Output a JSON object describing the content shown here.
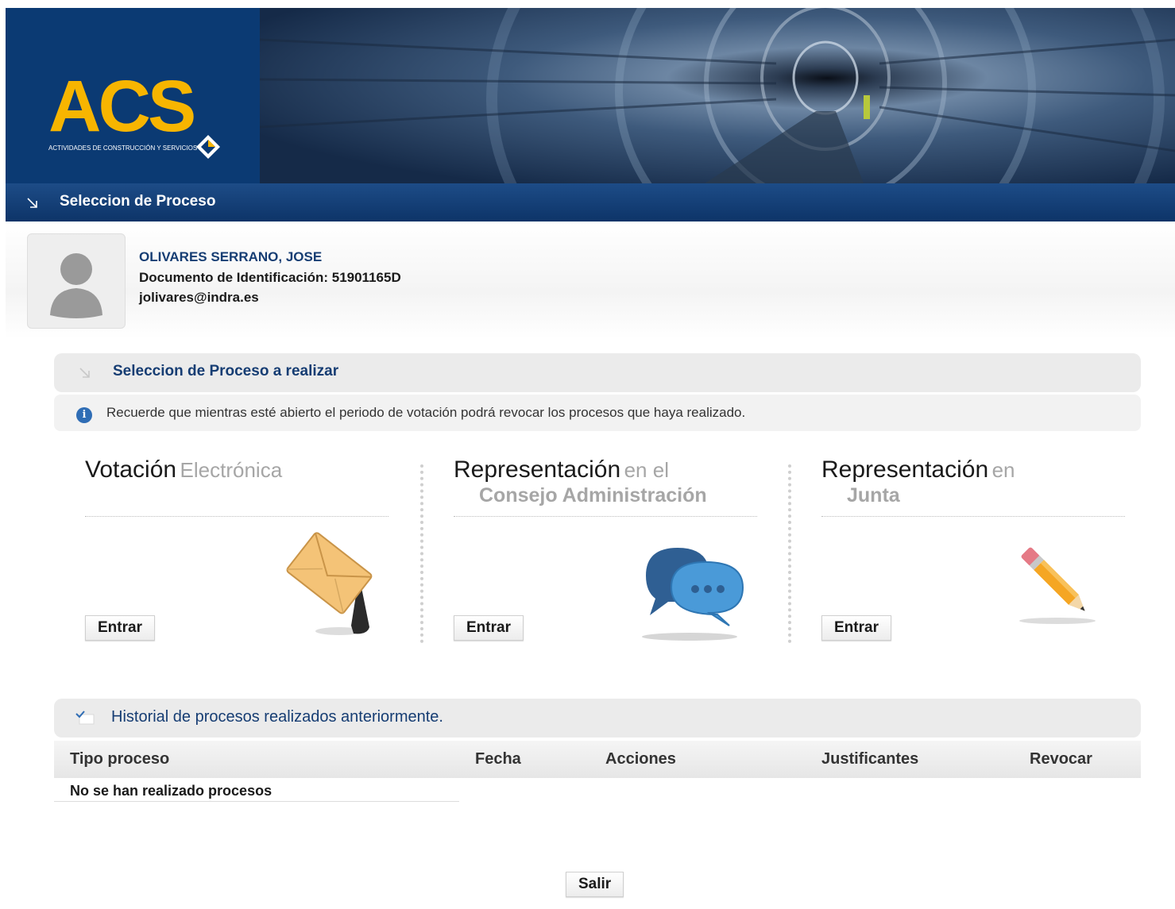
{
  "brand": {
    "logo_text": "ACS",
    "tagline": "ACTIVIDADES DE CONSTRUCCIÓN Y SERVICIOS"
  },
  "header": {
    "title": "Seleccion de Proceso"
  },
  "user": {
    "name": "OLIVARES SERRANO, JOSE",
    "document": "Documento de Identificación: 51901165D",
    "email": "jolivares@indra.es"
  },
  "selection": {
    "title": "Seleccion de Proceso a realizar",
    "notice": "Recuerde que mientras esté abierto el periodo de votación podrá revocar los procesos que haya realizado."
  },
  "processes": [
    {
      "title": "Votación",
      "subtitle": "Electrónica",
      "subtitle2": "",
      "button": "Entrar",
      "icon": "envelope-icon"
    },
    {
      "title": "Representación",
      "subtitle": "en el",
      "subtitle2": "Consejo Administración",
      "button": "Entrar",
      "icon": "speech-bubbles-icon"
    },
    {
      "title": "Representación",
      "subtitle": "en",
      "subtitle2": "Junta",
      "button": "Entrar",
      "icon": "pencil-icon"
    }
  ],
  "history": {
    "title": "Historial de procesos realizados anteriormente.",
    "columns": [
      "Tipo proceso",
      "Fecha",
      "Acciones",
      "Justificantes",
      "Revocar"
    ],
    "empty_message": "No se han realizado procesos"
  },
  "footer": {
    "exit_label": "Salir"
  },
  "colors": {
    "brand_blue": "#0b3a73",
    "brand_yellow": "#f7b500",
    "heading_blue": "#163d73"
  }
}
